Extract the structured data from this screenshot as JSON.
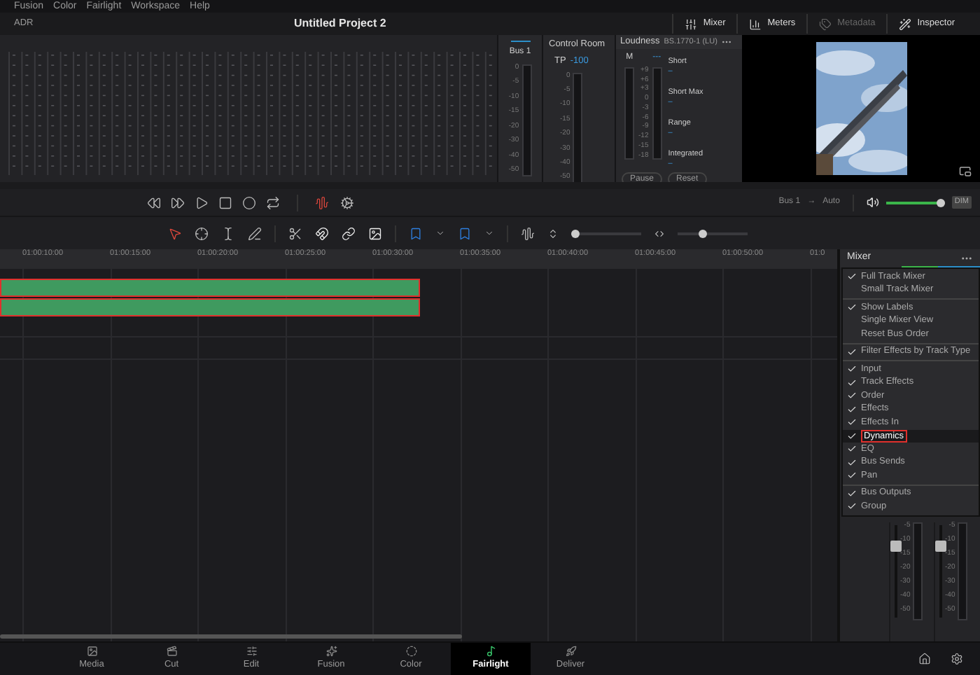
{
  "menu_bar": [
    "Fusion",
    "Color",
    "Fairlight",
    "Workspace",
    "Help"
  ],
  "title_bar": {
    "left_label": "ADR",
    "title": "Untitled Project 2",
    "buttons": [
      {
        "kind": "mixer",
        "label": "Mixer",
        "disabled": false
      },
      {
        "kind": "meters",
        "label": "Meters",
        "disabled": false
      },
      {
        "kind": "metadata",
        "label": "Metadata",
        "disabled": true
      },
      {
        "kind": "inspector",
        "label": "Inspector",
        "disabled": false
      }
    ]
  },
  "meters": {
    "bus": {
      "label": "Bus 1",
      "scale": [
        "0",
        "-5",
        "-10",
        "-15",
        "-20",
        "-30",
        "-40",
        "-50"
      ]
    },
    "control_room": {
      "title": "Control Room",
      "tp_label": "TP",
      "tp_value": "-100",
      "scale": [
        "0",
        "-5",
        "-10",
        "-15",
        "-20",
        "-30",
        "-40",
        "-50"
      ]
    },
    "loudness": {
      "title": "Loudness",
      "standard": "BS.1770-1 (LU)",
      "m_label": "M",
      "m_value": "---",
      "scale": [
        "+9",
        "+6",
        "+3",
        "0",
        "-3",
        "-6",
        "-9",
        "-12",
        "-15",
        "-18"
      ],
      "readouts": [
        {
          "label": "Short",
          "value": "–"
        },
        {
          "label": "Short Max",
          "value": "–"
        },
        {
          "label": "Range",
          "value": "–"
        },
        {
          "label": "Integrated",
          "value": "–"
        }
      ],
      "buttons": [
        "Pause",
        "Reset"
      ]
    }
  },
  "transport": {
    "bus_label": "Bus 1",
    "arrow": "→",
    "mode": "Auto",
    "volume": {
      "level": 0.92
    },
    "dim": "DIM"
  },
  "toolbar": {
    "zoom_sliders": [
      {
        "level": 0.0
      },
      {
        "level": 0.35
      }
    ]
  },
  "ruler": [
    "01:00:10:00",
    "01:00:15:00",
    "01:00:20:00",
    "01:00:25:00",
    "01:00:30:00",
    "01:00:35:00",
    "01:00:40:00",
    "01:00:45:00",
    "01:00:50:00",
    "01:0"
  ],
  "clips": [
    {
      "selected": true
    },
    {
      "selected": true
    }
  ],
  "mixer_panel": {
    "title": "Mixer",
    "menu": [
      [
        {
          "label": "Full Track Mixer",
          "checked": true,
          "selected": false
        },
        {
          "label": "Small Track Mixer",
          "checked": false,
          "selected": false
        }
      ],
      [
        {
          "label": "Show Labels",
          "checked": true,
          "selected": false
        },
        {
          "label": "Single Mixer View",
          "checked": false,
          "selected": false
        },
        {
          "label": "Reset Bus Order",
          "checked": false,
          "selected": false
        }
      ],
      [
        {
          "label": "Filter Effects by Track Type",
          "checked": true,
          "selected": false
        }
      ],
      [
        {
          "label": "Input",
          "checked": true,
          "selected": false
        },
        {
          "label": "Track Effects",
          "checked": true,
          "selected": false
        },
        {
          "label": "Order",
          "checked": true,
          "selected": false
        },
        {
          "label": "Effects",
          "checked": true,
          "selected": false
        },
        {
          "label": "Effects In",
          "checked": true,
          "selected": false
        },
        {
          "label": "Dynamics",
          "checked": true,
          "selected": true
        },
        {
          "label": "EQ",
          "checked": true,
          "selected": false
        },
        {
          "label": "Bus Sends",
          "checked": true,
          "selected": false
        },
        {
          "label": "Pan",
          "checked": true,
          "selected": false
        }
      ],
      [
        {
          "label": "Bus Outputs",
          "checked": true,
          "selected": false
        },
        {
          "label": "Group",
          "checked": true,
          "selected": false
        }
      ]
    ],
    "strips": [
      {
        "level": 0.8,
        "scale": [
          "-5",
          "-10",
          "-15",
          "-20",
          "-30",
          "-40",
          "-50"
        ]
      },
      {
        "level": 0.8,
        "scale": [
          "-5",
          "-10",
          "-15",
          "-20",
          "-30",
          "-40",
          "-50"
        ]
      }
    ]
  },
  "pages": [
    {
      "kind": "media",
      "label": "Media",
      "selected": false
    },
    {
      "kind": "cut",
      "label": "Cut",
      "selected": false
    },
    {
      "kind": "edit",
      "label": "Edit",
      "selected": false
    },
    {
      "kind": "fusion",
      "label": "Fusion",
      "selected": false
    },
    {
      "kind": "color",
      "label": "Color",
      "selected": false
    },
    {
      "kind": "fairlight",
      "label": "Fairlight",
      "selected": true
    },
    {
      "kind": "deliver",
      "label": "Deliver",
      "selected": false
    }
  ]
}
